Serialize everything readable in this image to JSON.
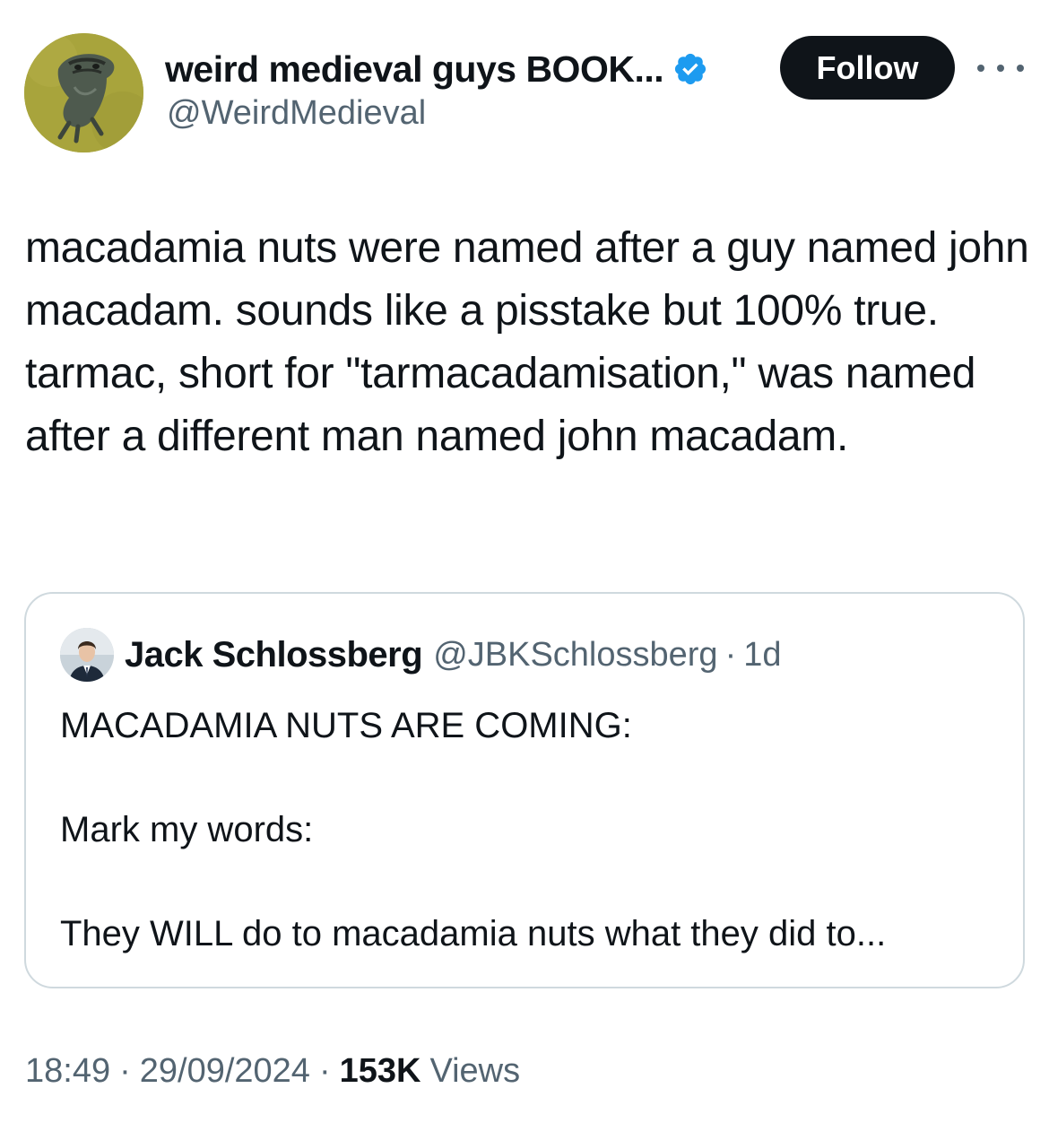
{
  "author": {
    "display_name": "weird medieval guys BOOK...",
    "handle": "@WeirdMedieval",
    "avatar_icon": "medieval-creature-avatar",
    "verified_icon": "verified-badge-icon",
    "verified_color": "#1d9bf0"
  },
  "actions": {
    "follow_label": "Follow",
    "more_icon": "more-horizontal-icon"
  },
  "tweet": {
    "text": "macadamia nuts were named after a guy named john macadam. sounds like a pisstake but 100% true. tarmac, short for \"tarmacadamisation,\" was named after a different man named john macadam."
  },
  "quote": {
    "display_name": "Jack Schlossberg",
    "handle": "@JBKSchlossberg",
    "separator": "·",
    "time": "1d",
    "avatar_icon": "user-avatar",
    "lines": [
      "MACADAMIA NUTS ARE COMING:",
      "Mark my words:",
      "They WILL do to macadamia nuts what they did to..."
    ]
  },
  "meta": {
    "time": "18:49",
    "separator": "·",
    "date": "29/09/2024",
    "views_count": "153K",
    "views_label": "Views"
  },
  "colors": {
    "text_primary": "#0f1419",
    "text_secondary": "#536471",
    "border": "#cfd9de",
    "follow_bg": "#0f1419"
  }
}
